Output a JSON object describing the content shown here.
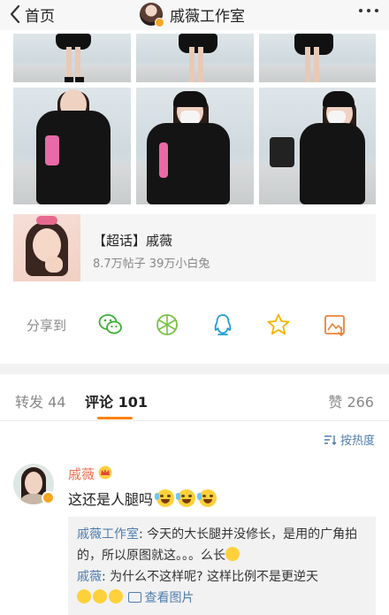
{
  "header": {
    "back_label": "首页",
    "title": "戚薇工作室"
  },
  "topic": {
    "title": "【超话】戚薇",
    "stats": "8.7万帖子 39万小白兔"
  },
  "share": {
    "label": "分享到",
    "targets": [
      "wechat-icon",
      "moments-icon",
      "qq-icon",
      "favorite-icon",
      "save-image-icon"
    ]
  },
  "tabs": {
    "repost": "转发 44",
    "comment": "评论 101",
    "like": "赞 266"
  },
  "sort": {
    "label": "按热度"
  },
  "comment": {
    "author": "戚薇",
    "text": "这还是人腿吗",
    "replies": [
      {
        "author": "戚薇工作室",
        "text": ": 今天的大长腿并没修长，是用的广角拍的，所以原图就这。。。么长"
      },
      {
        "author": "戚薇",
        "text": ": 为什么不这样呢? 这样比例不是更逆天",
        "link": "查看图片"
      }
    ]
  },
  "colors": {
    "accent": "#ff8200",
    "link": "#507daf",
    "name": "#eb7350",
    "wechat": "#3cb035",
    "moments": "#7ac143",
    "qq": "#1e9bd7",
    "favorite": "#f5b400",
    "save": "#e9823a"
  }
}
